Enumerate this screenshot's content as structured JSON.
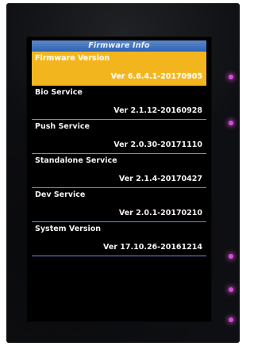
{
  "screen": {
    "title": "Firmware Info",
    "items": [
      {
        "label": "Firmware Version",
        "value": "Ver 6.6.4.1-20170905",
        "selected": true
      },
      {
        "label": "Bio Service",
        "value": "Ver 2.1.12-20160928",
        "selected": false
      },
      {
        "label": "Push Service",
        "value": "Ver 2.0.30-20171110",
        "selected": false
      },
      {
        "label": "Standalone Service",
        "value": "Ver 2.1.4-20170427",
        "selected": false
      },
      {
        "label": "Dev Service",
        "value": "Ver 2.0.1-20170210",
        "selected": false
      },
      {
        "label": "System Version",
        "value": "Ver 17.10.26-20161214",
        "selected": false
      }
    ]
  },
  "colors": {
    "title_bar": "#2f63b5",
    "selected_row": "#f2b51d",
    "divider": "#5f8fe0",
    "text": "#f2f2f2",
    "indicator_led": "#ff56ff"
  }
}
